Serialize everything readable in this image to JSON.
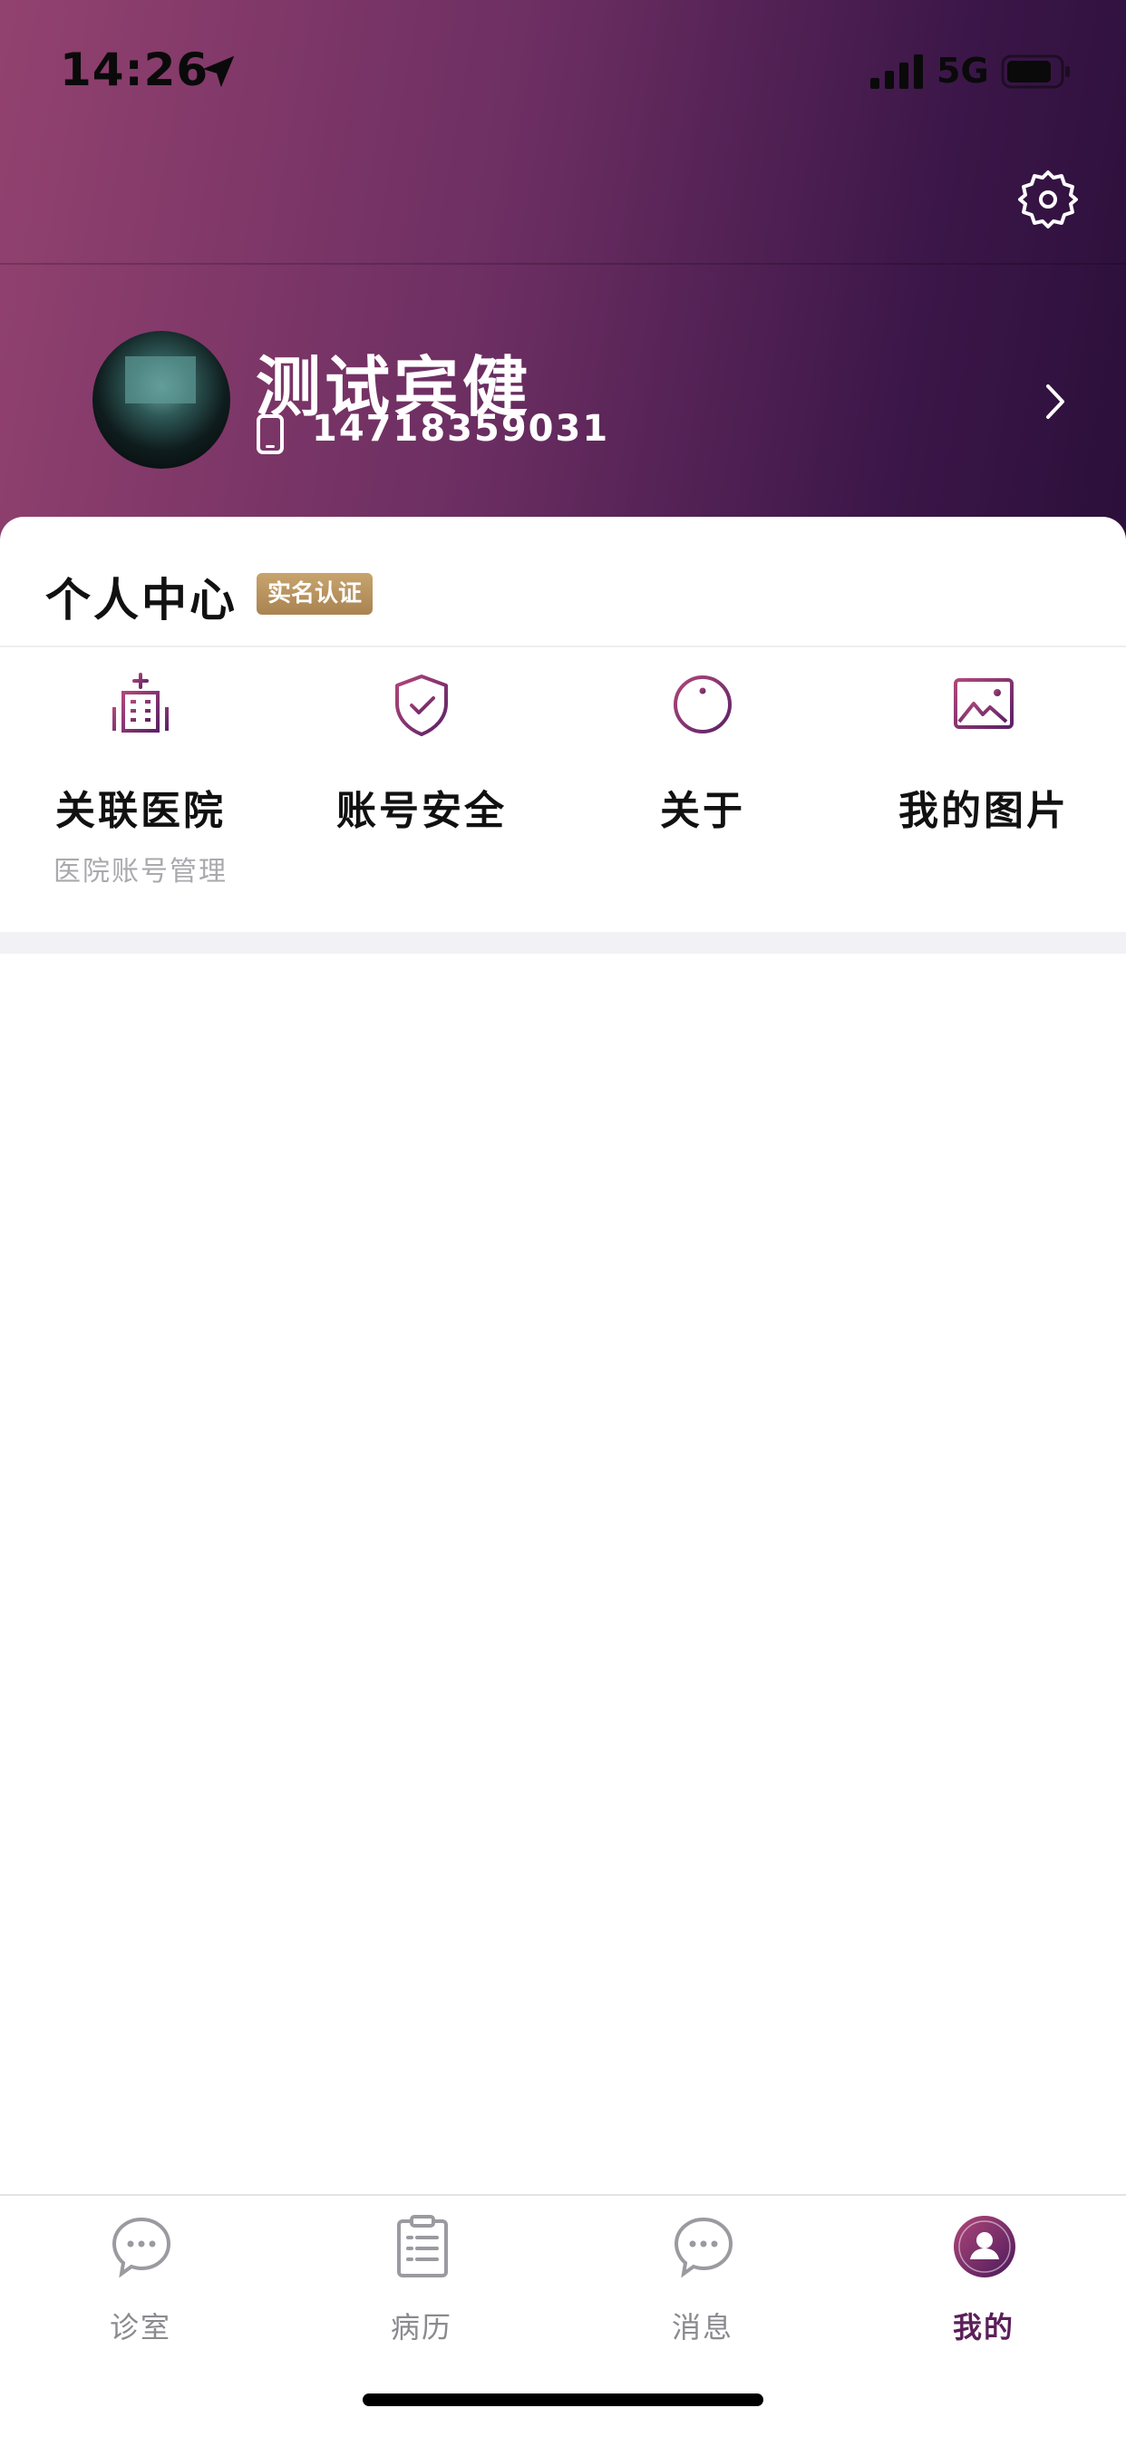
{
  "status_bar": {
    "time": "14:26",
    "network": "5G",
    "icons": [
      "location-arrow-icon",
      "signal-icon",
      "battery-icon"
    ]
  },
  "header": {
    "settings_icon": "gear-icon",
    "colors": {
      "gradient_start": "#93426f",
      "gradient_end": "#2b0f3a"
    }
  },
  "profile": {
    "name": "测试宾健",
    "phone": "14718359031"
  },
  "personal_center": {
    "title": "个人中心",
    "badge": "实名认证",
    "badge_color": "#b08d5a",
    "items": [
      {
        "label": "关联医院",
        "sublabel": "医院账号管理",
        "icon": "hospital-icon"
      },
      {
        "label": "账号安全",
        "sublabel": "",
        "icon": "shield-check-icon"
      },
      {
        "label": "关于",
        "sublabel": "",
        "icon": "info-icon"
      },
      {
        "label": "我的图片",
        "sublabel": "",
        "icon": "image-icon"
      }
    ]
  },
  "tabbar": {
    "tabs": [
      {
        "label": "诊室",
        "icon": "chat-bubble-icon",
        "active": false
      },
      {
        "label": "病历",
        "icon": "clipboard-icon",
        "active": false
      },
      {
        "label": "消息",
        "icon": "chat-bubble-icon",
        "active": false
      },
      {
        "label": "我的",
        "icon": "user-avatar-icon",
        "active": true
      }
    ],
    "active_color": "#5c1f5a",
    "inactive_color": "#8a8a8f"
  }
}
